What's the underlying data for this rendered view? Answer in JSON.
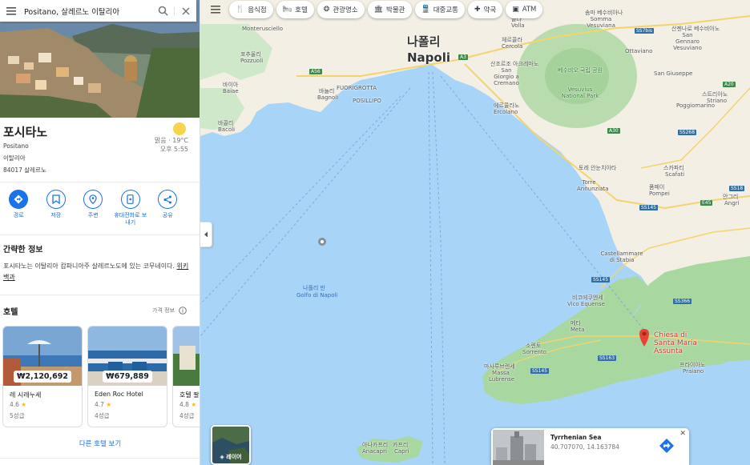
{
  "search": {
    "value": "Positano, 살레르노 이탈리아"
  },
  "place": {
    "name": "포시타노",
    "latin_name": "Positano",
    "country": "이탈리아",
    "postal": "84017 살레르노",
    "weather_condition": "맑음 · 19°C",
    "local_time": "오후 5:55"
  },
  "actions": [
    {
      "label": "경로",
      "icon": "directions-icon"
    },
    {
      "label": "저장",
      "icon": "bookmark-icon"
    },
    {
      "label": "주변",
      "icon": "nearby-icon"
    },
    {
      "label": "휴대전화로 보내기",
      "icon": "send-to-phone-icon"
    },
    {
      "label": "공유",
      "icon": "share-icon"
    }
  ],
  "about": {
    "title": "간략한 정보",
    "text": "포시타노는 이탈리아 캄파니아주 살레르노도에 있는 코무네이다.",
    "link": "위키백과"
  },
  "hotels": {
    "title": "호텔",
    "price_info": "가격 정보",
    "items": [
      {
        "name": "레 시레누세",
        "price": "₩2,120,692",
        "rating": "4.6",
        "class": "5성급"
      },
      {
        "name": "Eden Roc Hotel",
        "price": "₩679,889",
        "rating": "4.7",
        "class": "4성급"
      },
      {
        "name": "호텔 팔",
        "price": "",
        "rating": "4.8",
        "class": "4성급"
      }
    ],
    "more": "다른 호텔 보기"
  },
  "chips": [
    {
      "label": "음식점",
      "icon": "restaurant-icon"
    },
    {
      "label": "호텔",
      "icon": "hotel-icon"
    },
    {
      "label": "관광명소",
      "icon": "attraction-icon"
    },
    {
      "label": "박물관",
      "icon": "museum-icon"
    },
    {
      "label": "대중교통",
      "icon": "transit-icon"
    },
    {
      "label": "약국",
      "icon": "pharmacy-icon"
    },
    {
      "label": "ATM",
      "icon": "atm-icon"
    }
  ],
  "layer": {
    "label": "레이어"
  },
  "info_card": {
    "title": "Tyrrhenian Sea",
    "coords": "40.707070, 14.163784"
  },
  "map_labels": {
    "napoli_ko": "나폴리",
    "napoli_en": "Napoli",
    "gulf_ko": "나폴리 만",
    "gulf_en": "Golfo di Napoli",
    "pozzuoli_ko": "포추올리",
    "pozzuoli_en": "Pozzuoli",
    "monterusciello": "Monterusciello",
    "bagnoli_ko": "바뇰리",
    "bagnoli_en": "Bagnoli",
    "fuorigrotta": "FUORIGROTTA",
    "posillipo": "POSILLIPO",
    "baiae_ko": "바이아",
    "baiae_en": "Baiae",
    "bacoli_ko": "바콜리",
    "bacoli_en": "Bacoli",
    "cercola_ko": "체르콜라",
    "cercola_en": "Cercola",
    "volla_ko": "볼라",
    "volla_en": "Volla",
    "sangiorgio_ko": "산조르조 아크레마노",
    "sangiorgio_en": "San Giorgio a Cremano",
    "ercolano_ko": "에르콜라노",
    "ercolano_en": "Ercolano",
    "vesuvius_ko": "베수비오 국립 공원",
    "vesuvius_en": "Vesuvius National Park",
    "somma_ko": "솜마 베수비아나",
    "somma_en": "Somma Vesuviana",
    "sangennaro_ko": "산젠나로 베수비아노",
    "sangennaro_en": "San Gennaro Vesuviano",
    "ottaviano": "Ottaviano",
    "sangiuseppe": "San Giuseppe",
    "poggiomarino": "Poggiomarino",
    "striano_ko": "스트리아노",
    "striano_en": "Striano",
    "torre_ko": "토레 안눈치아타",
    "torre_en": "Torre Annunziata",
    "pompei_ko": "폼페이",
    "pompei_en": "Pompei",
    "scafati_ko": "스카파티",
    "scafati_en": "Scafati",
    "angri_ko": "안그리",
    "angri_en": "Angri",
    "castellammare": "Castellammare di Stabia",
    "vico_ko": "비코에쿠엔세",
    "vico_en": "Vico Equense",
    "meta_ko": "메타",
    "meta_en": "Meta",
    "sorrento_ko": "소렌토",
    "sorrento_en": "Sorrento",
    "massa_ko": "마사루브렌세",
    "massa_en": "Massa Lubrense",
    "praiano_ko": "프라이아노",
    "praiano_en": "Praiano",
    "chiesa": "Chiesa di Santa Maria Assunta",
    "anacapri_ko": "아나카프리",
    "anacapri_en": "Anacapri",
    "capri_ko": "카프리",
    "capri_en": "Capri",
    "road_a56": "A56",
    "road_a3": "A3",
    "road_a30": "A30",
    "road_ss268": "SS268",
    "road_ss145": "SS145",
    "road_ss163": "SS163",
    "road_ss366": "SS366",
    "road_e45": "E45",
    "road_a20": "A20",
    "road_ss18": "SS18",
    "road_ss7bis": "SS7bis"
  }
}
